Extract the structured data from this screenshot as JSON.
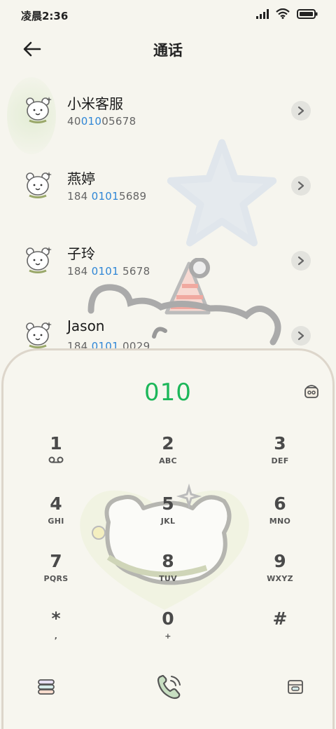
{
  "status_bar": {
    "time": "凌晨2:36",
    "icons": [
      "signal-icon",
      "wifi-icon",
      "battery-icon"
    ]
  },
  "header": {
    "title": "通话",
    "back_icon": "arrow-left-icon"
  },
  "contacts": [
    {
      "name": "小米客服",
      "number_parts": [
        "40",
        "010",
        "05678"
      ]
    },
    {
      "name": "燕婷",
      "number_parts": [
        "184 ",
        "0101",
        "5689"
      ]
    },
    {
      "name": "子玲",
      "number_parts": [
        "184 ",
        "0101",
        " 5678"
      ]
    },
    {
      "name": "Jason",
      "number_parts": [
        "184 ",
        "0101",
        " 0029"
      ]
    }
  ],
  "dialer": {
    "input_value": "010",
    "input_color": "#1db75a",
    "keys": [
      {
        "digit": "1",
        "letters": "",
        "sub_icon": "voicemail-icon"
      },
      {
        "digit": "2",
        "letters": "ABC"
      },
      {
        "digit": "3",
        "letters": "DEF"
      },
      {
        "digit": "4",
        "letters": "GHI"
      },
      {
        "digit": "5",
        "letters": "JKL"
      },
      {
        "digit": "6",
        "letters": "MNO"
      },
      {
        "digit": "7",
        "letters": "PQRS"
      },
      {
        "digit": "8",
        "letters": "TUV"
      },
      {
        "digit": "9",
        "letters": "WXYZ"
      },
      {
        "digit": "*",
        "letters": ","
      },
      {
        "digit": "0",
        "letters": "+"
      },
      {
        "digit": "#",
        "letters": ""
      }
    ],
    "bottom_icons": [
      "menu-stack-icon",
      "phone-call-icon",
      "dialpad-toggle-icon"
    ],
    "clear_icon": "clear-input-icon"
  },
  "colors": {
    "accent_green": "#1db75a",
    "highlight_blue": "#2f86d6",
    "background": "#f6f5ee"
  }
}
